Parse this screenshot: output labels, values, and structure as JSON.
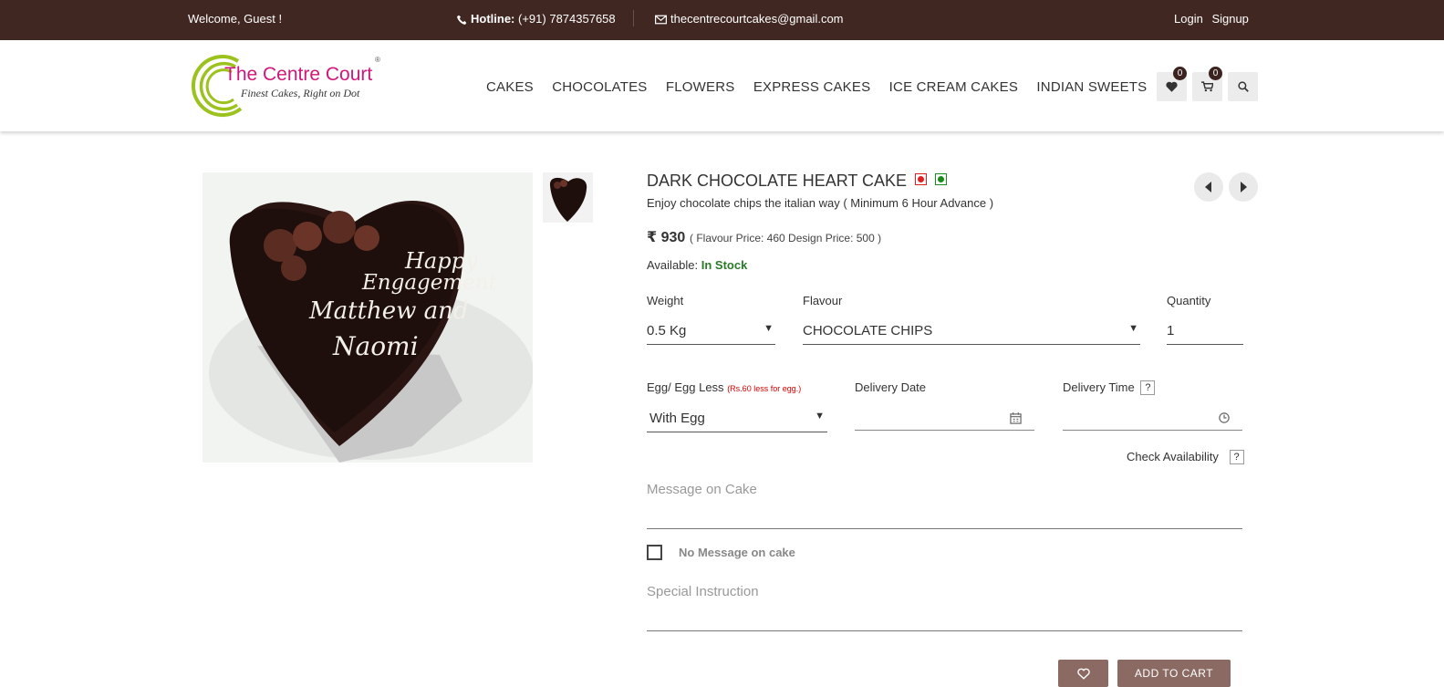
{
  "topbar": {
    "welcome": "Welcome, Guest !",
    "hotline_label": "Hotline:",
    "hotline_number": "(+91) 7874357658",
    "email": "thecentrecourtcakes@gmail.com",
    "login": "Login",
    "signup": "Signup"
  },
  "logo": {
    "brand": "The Centre Court",
    "tagline": "Finest Cakes, Right on Dot",
    "reg": "®"
  },
  "nav": [
    "CAKES",
    "CHOCOLATES",
    "FLOWERS",
    "EXPRESS CAKES",
    "ICE CREAM CAKES",
    "INDIAN SWEETS"
  ],
  "header_icons": {
    "wishlist_count": "0",
    "cart_count": "0"
  },
  "product": {
    "title": "DARK CHOCOLATE HEART CAKE",
    "subtitle": "Enjoy chocolate chips the italian way ( Minimum 6 Hour Advance )",
    "currency": "₹",
    "price": "930",
    "price_breakdown": "( Flavour Price: 460  Design Price: 500 )",
    "available_label": "Available:",
    "available_value": "In Stock",
    "cake_text": [
      "Happy",
      "Engagement",
      "Matthew and",
      "Naomi"
    ],
    "veg_colors": {
      "nonveg": "#e02020",
      "veg": "#1a8a1a"
    }
  },
  "form": {
    "weight_label": "Weight",
    "weight_value": "0.5 Kg",
    "flavour_label": "Flavour",
    "flavour_value": "CHOCOLATE CHIPS",
    "quantity_label": "Quantity",
    "quantity_value": "1",
    "egg_label": "Egg/ Egg Less",
    "egg_note": "(Rs.60 less for egg.)",
    "egg_value": "With Egg",
    "date_label": "Delivery Date",
    "time_label": "Delivery Time",
    "help": "?",
    "check_availability": "Check Availability",
    "message_placeholder": "Message on Cake",
    "no_message_label": "No Message on cake",
    "instruction_placeholder": "Special Instruction"
  },
  "buttons": {
    "add_to_cart": "ADD TO CART"
  }
}
